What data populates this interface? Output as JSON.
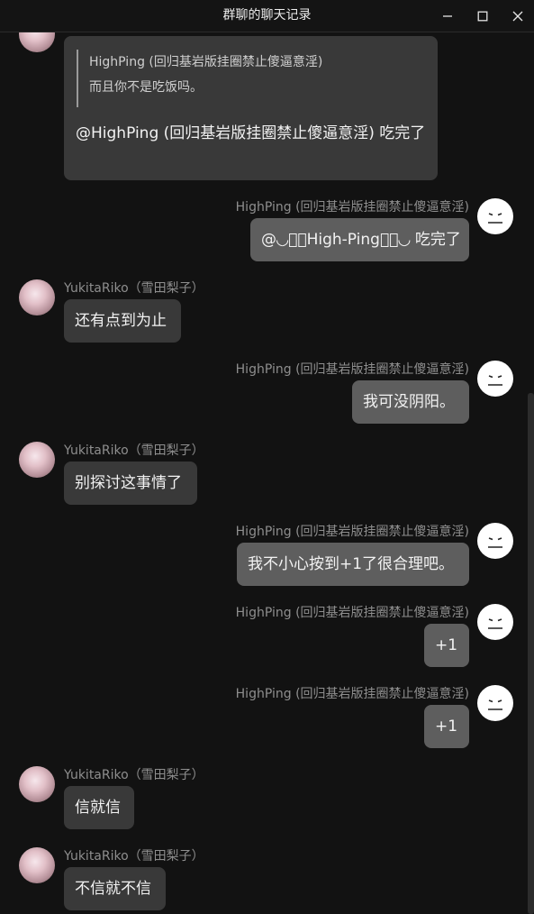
{
  "window": {
    "title": "群聊的聊天记录",
    "icons": {
      "minimize": "minimize-icon",
      "maximize": "maximize-icon",
      "close": "close-icon"
    }
  },
  "colors": {
    "background": "#121212",
    "left_bubble": "#393939",
    "right_bubble": "#5e5e5e",
    "sender_text": "#8e8e8e"
  },
  "messages": [
    {
      "sender": "",
      "side": "left",
      "quote": {
        "sender": "HighPing (回归基岩版挂圈禁止傻逼意淫)",
        "text": "而且你不是吃饭吗。"
      },
      "text": "@HighPing (回归基岩版挂圈禁止傻逼意淫) 吃完了"
    },
    {
      "sender": "HighPing (回归基岩版挂圈禁止傻逼意淫)",
      "side": "right",
      "text": "@◟◞ঞ͛High-Pingঞ͛◟◞ 吃完了"
    },
    {
      "sender": "YukitaRiko（雪田梨子）",
      "side": "left",
      "text": "还有点到为止"
    },
    {
      "sender": "HighPing (回归基岩版挂圈禁止傻逼意淫)",
      "side": "right",
      "text": "我可没阴阳。"
    },
    {
      "sender": "YukitaRiko（雪田梨子）",
      "side": "left",
      "text": "别探讨这事情了"
    },
    {
      "sender": "HighPing (回归基岩版挂圈禁止傻逼意淫)",
      "side": "right",
      "text": "我不小心按到+1了很合理吧。"
    },
    {
      "sender": "HighPing (回归基岩版挂圈禁止傻逼意淫)",
      "side": "right",
      "text": "+1"
    },
    {
      "sender": "HighPing (回归基岩版挂圈禁止傻逼意淫)",
      "side": "right",
      "text": "+1"
    },
    {
      "sender": "YukitaRiko（雪田梨子）",
      "side": "left",
      "text": "信就信"
    },
    {
      "sender": "YukitaRiko（雪田梨子）",
      "side": "left",
      "text": "不信就不信"
    }
  ]
}
